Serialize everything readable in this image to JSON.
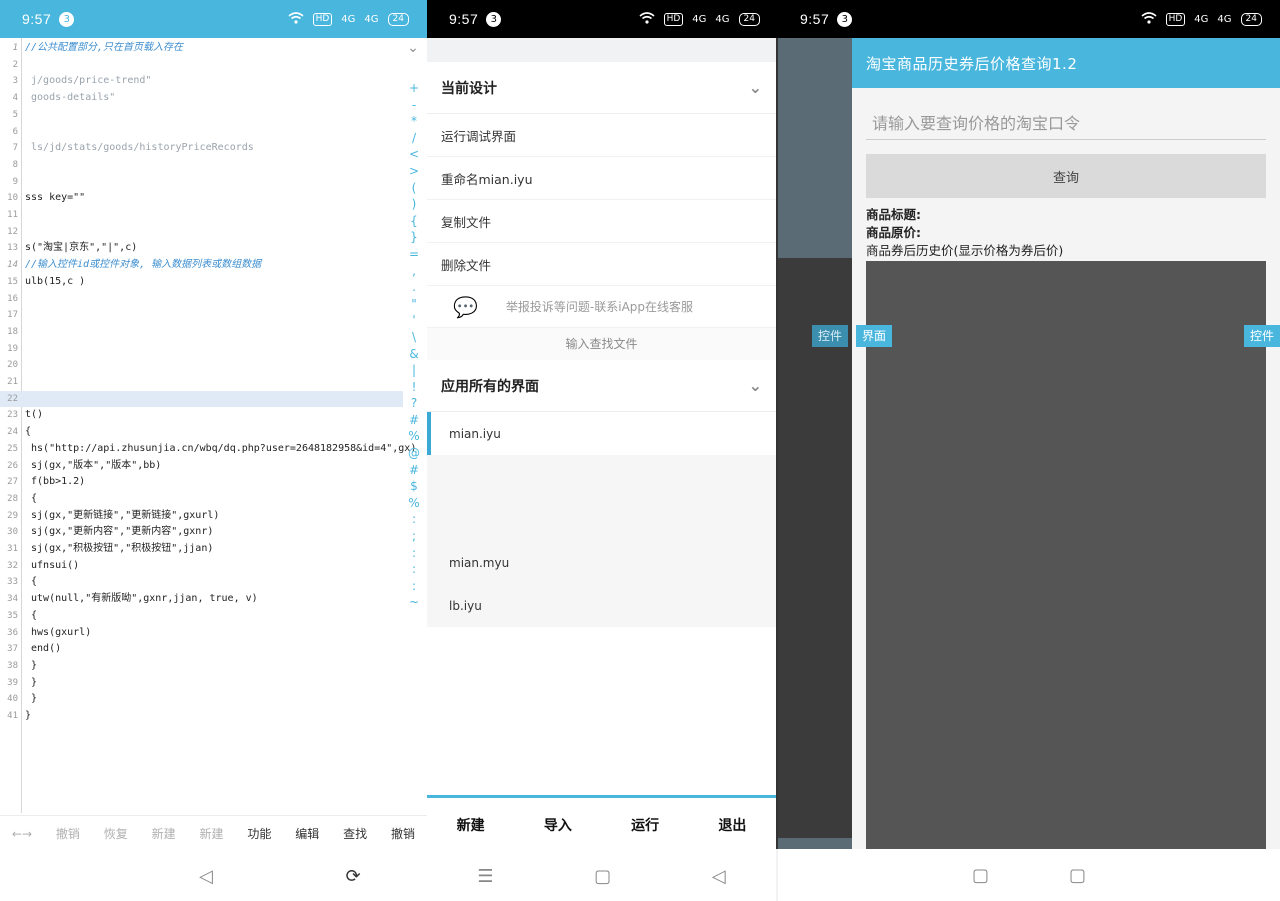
{
  "status": {
    "time": "9:57",
    "badge": "3",
    "hd": "HD",
    "net1": "4G",
    "net2": "4G",
    "battery": "24"
  },
  "editor": {
    "lines": [
      {
        "n": "1",
        "t": "//公共配置部分,只在首页载入存在",
        "cls": "comment"
      },
      {
        "n": "2",
        "t": "",
        "cls": ""
      },
      {
        "n": "3",
        "t": "                                   j/goods/price-trend\"",
        "cls": "faded"
      },
      {
        "n": "4",
        "t": "                                  goods-details\"",
        "cls": "faded"
      },
      {
        "n": "5",
        "t": "",
        "cls": ""
      },
      {
        "n": "6",
        "t": "",
        "cls": ""
      },
      {
        "n": "7",
        "t": "                             ls/jd/stats/goods/historyPriceRecords",
        "cls": "faded"
      },
      {
        "n": "8",
        "t": "",
        "cls": ""
      },
      {
        "n": "9",
        "t": "",
        "cls": ""
      },
      {
        "n": "10",
        "t": "sss key=\"\"",
        "cls": ""
      },
      {
        "n": "11",
        "t": "",
        "cls": ""
      },
      {
        "n": "12",
        "t": "",
        "cls": ""
      },
      {
        "n": "13",
        "t": "s(\"淘宝|京东\",\"|\",c)",
        "cls": ""
      },
      {
        "n": "14",
        "t": "//输入控件id或控件对象, 输入数据列表或数组数据",
        "cls": "comment"
      },
      {
        "n": "15",
        "t": "ulb(15,c )",
        "cls": ""
      },
      {
        "n": "16",
        "t": "",
        "cls": ""
      },
      {
        "n": "17",
        "t": "",
        "cls": ""
      },
      {
        "n": "18",
        "t": "",
        "cls": ""
      },
      {
        "n": "19",
        "t": "",
        "cls": ""
      },
      {
        "n": "20",
        "t": "",
        "cls": ""
      },
      {
        "n": "21",
        "t": "",
        "cls": ""
      },
      {
        "n": "22",
        "t": "",
        "cls": "highlight"
      },
      {
        "n": "23",
        "t": "t()",
        "cls": ""
      },
      {
        "n": "24",
        "t": "{",
        "cls": ""
      },
      {
        "n": "25",
        "t": "  hs(\"http://api.zhusunjia.cn/wbq/dq.php?user=2648182958&id=4\",gx)",
        "cls": ""
      },
      {
        "n": "26",
        "t": "  sj(gx,\"版本\",\"版本\",bb)",
        "cls": ""
      },
      {
        "n": "27",
        "t": "  f(bb>1.2)",
        "cls": ""
      },
      {
        "n": "28",
        "t": "  {",
        "cls": ""
      },
      {
        "n": "29",
        "t": "    sj(gx,\"更新链接\",\"更新链接\",gxurl)",
        "cls": ""
      },
      {
        "n": "30",
        "t": "    sj(gx,\"更新内容\",\"更新内容\",gxnr)",
        "cls": ""
      },
      {
        "n": "31",
        "t": "    sj(gx,\"积极按钮\",\"积极按钮\",jjan)",
        "cls": ""
      },
      {
        "n": "32",
        "t": "    ufnsui()",
        "cls": ""
      },
      {
        "n": "33",
        "t": "    {",
        "cls": ""
      },
      {
        "n": "34",
        "t": "   utw(null,\"有新版呦\",gxnr,jjan, true, v)",
        "cls": ""
      },
      {
        "n": "35",
        "t": "   {",
        "cls": ""
      },
      {
        "n": "36",
        "t": "     hws(gxurl)",
        "cls": ""
      },
      {
        "n": "37",
        "t": "     end()",
        "cls": ""
      },
      {
        "n": "38",
        "t": "   }",
        "cls": ""
      },
      {
        "n": "39",
        "t": "   }",
        "cls": ""
      },
      {
        "n": "40",
        "t": "  }",
        "cls": ""
      },
      {
        "n": "41",
        "t": "}",
        "cls": ""
      }
    ],
    "symbols": [
      "+",
      "-",
      "*",
      "/",
      "<",
      ">",
      "(",
      ")",
      "{",
      "}",
      "=",
      ",",
      ".",
      "\"",
      "'",
      "\\",
      "&",
      "|",
      "!",
      "?",
      "#",
      "%",
      "@",
      "#",
      "$",
      "%",
      ":",
      ";",
      ":",
      ":",
      ":",
      "~"
    ],
    "toolbar": [
      "←→",
      "撤销",
      "恢复",
      "新建",
      "新建",
      "功能",
      "编辑",
      "查找",
      "撤销"
    ],
    "toolbar_dim": [
      true,
      true,
      true,
      true,
      true,
      false,
      false,
      false,
      false
    ]
  },
  "drawer": {
    "current_design": "当前设计",
    "items": [
      "运行调试界面",
      "重命名mian.iyu",
      "复制文件",
      "删除文件"
    ],
    "report": "举报投诉等问题-联系iApp在线客服",
    "search_file": "输入查找文件",
    "all_screens": "应用所有的界面",
    "files": [
      "mian.iyu",
      "",
      "",
      "mian.myu",
      "lb.iyu"
    ],
    "tabs": [
      "新建",
      "导入",
      "运行",
      "退出"
    ]
  },
  "app": {
    "title": "淘宝商品历史券后价格查询1.2",
    "input_placeholder": "请输入要查询价格的淘宝口令",
    "query_button": "查询",
    "label_title": "商品标题:",
    "label_price": "商品原价:",
    "label_history": "商品券后历史价(显示价格为券后价)",
    "tag_left_dim": "控件",
    "tag_left": "界面",
    "tag_right": "控件"
  },
  "colors": {
    "accent": "#49b6de",
    "chart_bg": "#555555"
  }
}
